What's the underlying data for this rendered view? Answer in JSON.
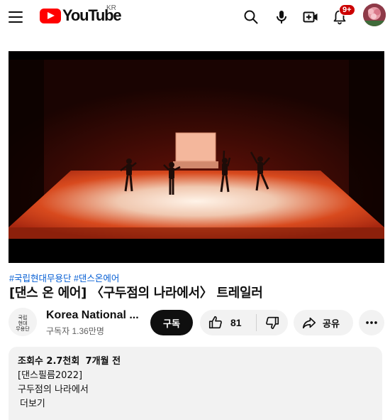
{
  "header": {
    "logo_text": "YouTube",
    "region": "KR",
    "notification_count": "9+",
    "icons": [
      "menu-icon",
      "search-icon",
      "mic-icon",
      "create-icon",
      "bell-icon"
    ],
    "brand_color": "#ff0000"
  },
  "video": {
    "hashtags": [
      "#국립현대무용단",
      "#댄스온에어"
    ],
    "title": "[댄스 온 에어] 〈구두점의 나라에서〉 트레일러"
  },
  "channel": {
    "name": "Korea National ...",
    "subscribers": "구독자 1.36만명",
    "avatar_text": "국립현대무용단"
  },
  "actions": {
    "subscribe_label": "구독",
    "like_count": "81",
    "share_label": "공유"
  },
  "description": {
    "views": "조회수 2.7천회",
    "time_ago": "7개월 전",
    "lines": [
      "[댄스필름2022]",
      "구두점의 나라에서"
    ],
    "more_label": "더보기"
  }
}
